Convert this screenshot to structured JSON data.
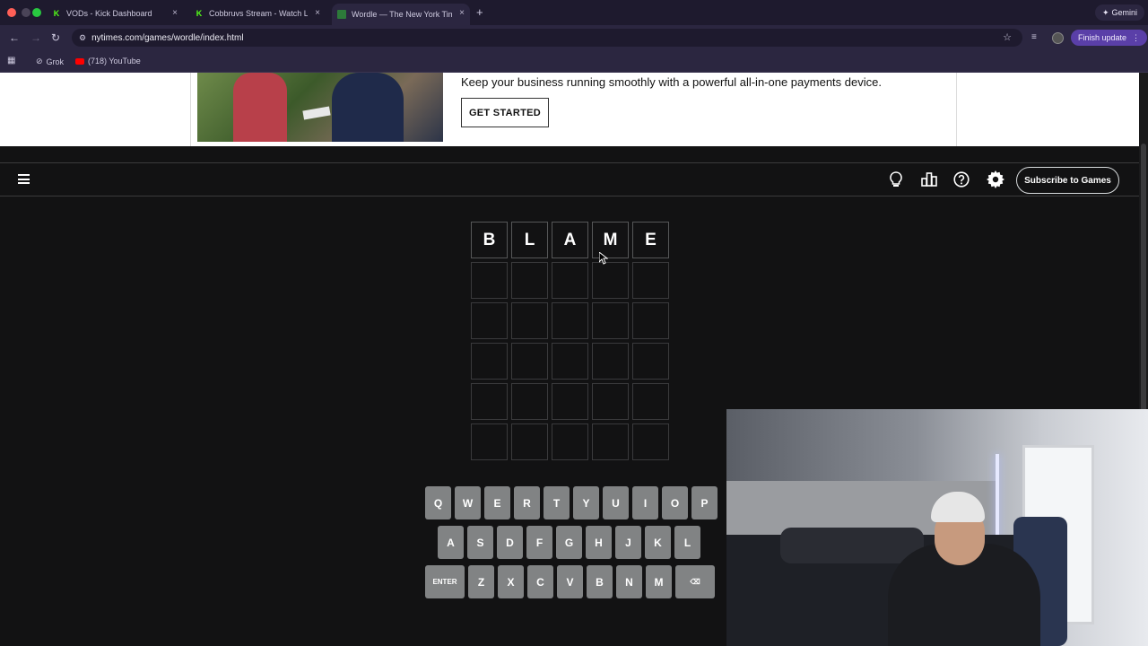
{
  "browser": {
    "tabs": [
      {
        "title": "VODs - Kick Dashboard",
        "close": "×"
      },
      {
        "title": "Cobbruvs Stream - Watch Live",
        "close": "×"
      },
      {
        "title": "Wordle — The New York Times",
        "close": "×"
      }
    ],
    "new_tab": "+",
    "gemini_label": "Gemini",
    "url": "nytimes.com/games/wordle/index.html",
    "finish_update": "Finish update",
    "bookmarks": [
      {
        "label": "Grok"
      },
      {
        "label": "(718) YouTube"
      }
    ]
  },
  "ad": {
    "text": "Keep your business running smoothly with a powerful all-in-one payments device.",
    "button": "GET STARTED"
  },
  "header": {
    "subscribe": "Subscribe to Games"
  },
  "board": {
    "rows": [
      [
        "B",
        "L",
        "A",
        "M",
        "E"
      ],
      [
        "",
        "",
        "",
        "",
        ""
      ],
      [
        "",
        "",
        "",
        "",
        ""
      ],
      [
        "",
        "",
        "",
        "",
        ""
      ],
      [
        "",
        "",
        "",
        "",
        ""
      ],
      [
        "",
        "",
        "",
        "",
        ""
      ]
    ]
  },
  "keyboard": {
    "row1": [
      "Q",
      "W",
      "E",
      "R",
      "T",
      "Y",
      "U",
      "I",
      "O",
      "P"
    ],
    "row2": [
      "A",
      "S",
      "D",
      "F",
      "G",
      "H",
      "J",
      "K",
      "L"
    ],
    "row3": [
      "ENTER",
      "Z",
      "X",
      "C",
      "V",
      "B",
      "N",
      "M",
      "⌫"
    ]
  }
}
